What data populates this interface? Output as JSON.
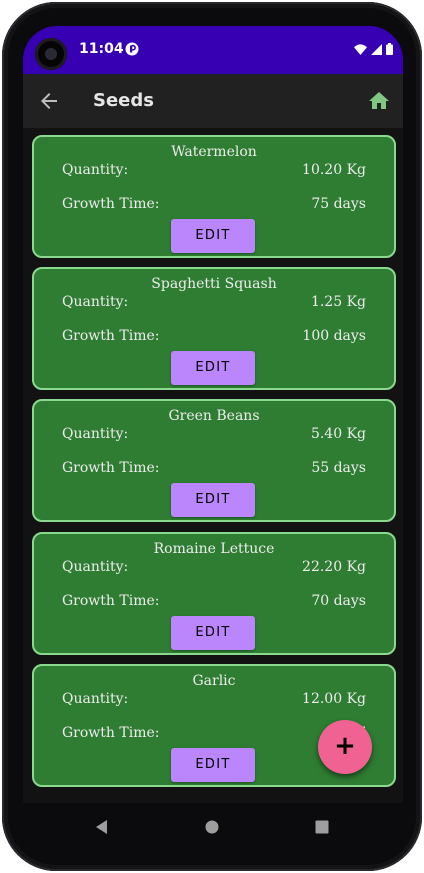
{
  "status_bar": {
    "time": "11:04",
    "icons": [
      "app-notification-icon",
      "wifi-icon",
      "cellular-signal-icon",
      "battery-icon"
    ]
  },
  "app_bar": {
    "title": "Seeds",
    "back_icon": "arrow-back-icon",
    "home_icon": "home-icon"
  },
  "seeds": [
    {
      "name": "Watermelon",
      "quantity_label": "Quantity:",
      "quantity": "10.20 Kg",
      "growth_label": "Growth Time:",
      "growth": "75 days",
      "edit_label": "EDIT"
    },
    {
      "name": "Spaghetti Squash",
      "quantity_label": "Quantity:",
      "quantity": "1.25 Kg",
      "growth_label": "Growth Time:",
      "growth": "100 days",
      "edit_label": "EDIT"
    },
    {
      "name": "Green Beans",
      "quantity_label": "Quantity:",
      "quantity": "5.40 Kg",
      "growth_label": "Growth Time:",
      "growth": "55 days",
      "edit_label": "EDIT"
    },
    {
      "name": "Romaine Lettuce",
      "quantity_label": "Quantity:",
      "quantity": "22.20 Kg",
      "growth_label": "Growth Time:",
      "growth": "70 days",
      "edit_label": "EDIT"
    },
    {
      "name": "Garlic",
      "quantity_label": "Quantity:",
      "quantity": "12.00 Kg",
      "growth_label": "Growth Time:",
      "growth": "7",
      "edit_label": "EDIT"
    }
  ],
  "fab": {
    "label": "+"
  },
  "nav_bar": {
    "icons": [
      "back-triangle-icon",
      "home-circle-icon",
      "recents-square-icon"
    ]
  },
  "colors": {
    "status_bar": "#3700b3",
    "app_bar": "#212121",
    "card_background": "#2e7d32",
    "card_border": "#8bd98f",
    "edit_button": "#bb86fc",
    "fab": "#f06292",
    "home_icon": "#81c784"
  }
}
